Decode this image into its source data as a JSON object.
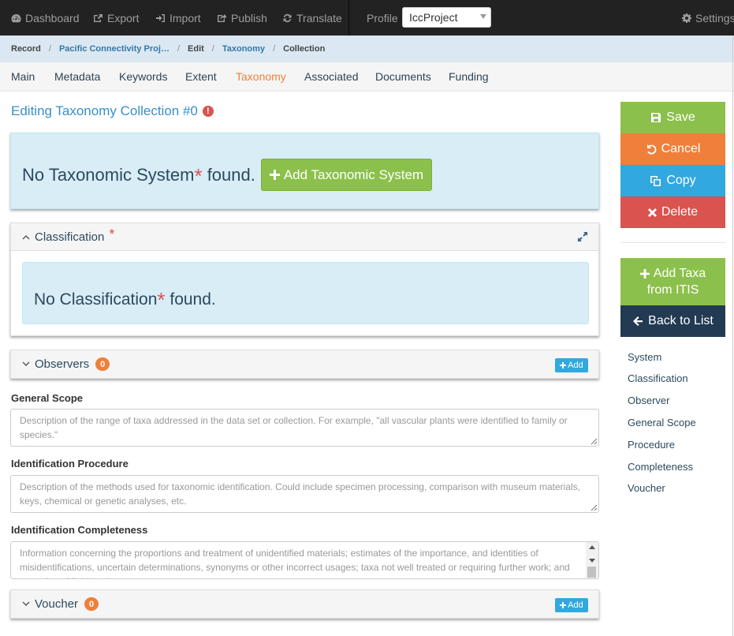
{
  "topbar": {
    "dashboard": "Dashboard",
    "export": "Export",
    "import": "Import",
    "publish": "Publish",
    "translate": "Translate",
    "profile_label": "Profile",
    "profile_value": "IccProject",
    "settings": "Settings"
  },
  "breadcrumb": {
    "record": "Record",
    "project": "Pacific Connectivity Proj…",
    "edit": "Edit",
    "taxonomy": "Taxonomy",
    "collection": "Collection",
    "sep": "/"
  },
  "tabs": [
    "Main",
    "Metadata",
    "Keywords",
    "Extent",
    "Taxonomy",
    "Associated",
    "Documents",
    "Funding"
  ],
  "active_tab": "Taxonomy",
  "page_title": "Editing Taxonomy Collection #0",
  "taxonomic_system": {
    "msg_before": "No Taxonomic System",
    "required_mark": "*",
    "msg_after": " found.",
    "add_button": "Add Taxonomic System"
  },
  "classification": {
    "title": "Classification",
    "required_mark": "*",
    "msg_before": "No Classification",
    "msg_after": " found."
  },
  "observers": {
    "title": "Observers",
    "count": "0",
    "add_label": "Add"
  },
  "general_scope": {
    "label": "General Scope",
    "placeholder": "Description of the range of taxa addressed in the data set or collection. For example, \"all vascular plants were identified to family or species.\""
  },
  "identification_procedure": {
    "label": "Identification Procedure",
    "placeholder": "Description of the methods used for taxonomic identification. Could include specimen processing, comparison with museum materials, keys, chemical or genetic analyses, etc."
  },
  "identification_completeness": {
    "label": "Identification Completeness",
    "placeholder": "Information concerning the proportions and treatment of unidentified materials; estimates of the importance, and identities of misidentifications, uncertain determinations, synonyms or other incorrect usages; taxa not well treated or requiring further work; and expertise of field workers."
  },
  "voucher": {
    "title": "Voucher",
    "count": "0",
    "add_label": "Add"
  },
  "sidebar": {
    "save": "Save",
    "cancel": "Cancel",
    "copy": "Copy",
    "delete": "Delete",
    "add_taxa_line1": "Add Taxa",
    "add_taxa_line2": "from ITIS",
    "back_to_list": "Back to List",
    "links": [
      "System",
      "Classification",
      "Observer",
      "General Scope",
      "Procedure",
      "Completeness",
      "Voucher"
    ]
  },
  "colors": {
    "save": "#8cc04c",
    "cancel": "#ef7f3a",
    "copy": "#31a8df",
    "delete": "#d9534f",
    "add_taxa": "#8cc04c",
    "back_to_list": "#223a52",
    "accent_link": "#3a8fc5",
    "active_tab": "#ef7f3a"
  }
}
